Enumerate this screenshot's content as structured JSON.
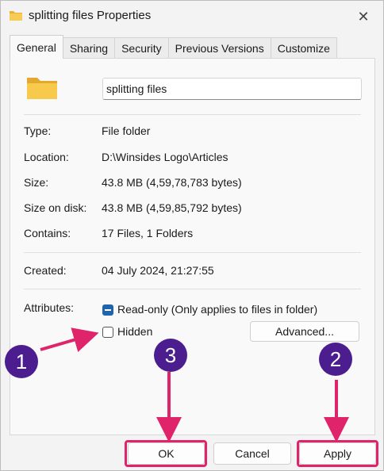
{
  "window": {
    "title": "splitting files Properties",
    "close_glyph": "✕"
  },
  "tabs": [
    {
      "label": "General",
      "active": true
    },
    {
      "label": "Sharing",
      "active": false
    },
    {
      "label": "Security",
      "active": false
    },
    {
      "label": "Previous Versions",
      "active": false
    },
    {
      "label": "Customize",
      "active": false
    }
  ],
  "general": {
    "folder_name": "splitting files",
    "rows": [
      {
        "label": "Type:",
        "value": "File folder"
      },
      {
        "label": "Location:",
        "value": "D:\\Winsides Logo\\Articles"
      },
      {
        "label": "Size:",
        "value": "43.8 MB (4,59,78,783 bytes)"
      },
      {
        "label": "Size on disk:",
        "value": "43.8 MB (4,59,85,792 bytes)"
      },
      {
        "label": "Contains:",
        "value": "17 Files, 1 Folders"
      }
    ],
    "created_label": "Created:",
    "created_value": "04 July 2024, 21:27:55",
    "attributes_label": "Attributes:",
    "readonly_label": "Read-only (Only applies to files in folder)",
    "readonly_state": "indeterminate",
    "hidden_label": "Hidden",
    "hidden_checked": false,
    "advanced_label": "Advanced..."
  },
  "buttons": {
    "ok": "OK",
    "cancel": "Cancel",
    "apply": "Apply"
  },
  "annotations": {
    "badge_1": "1",
    "badge_2": "2",
    "badge_3": "3",
    "highlight_color": "#e0246c",
    "badge_color": "#4b1d8f"
  },
  "colors": {
    "accent": "#1f64ad",
    "folder": "#f5c542"
  }
}
